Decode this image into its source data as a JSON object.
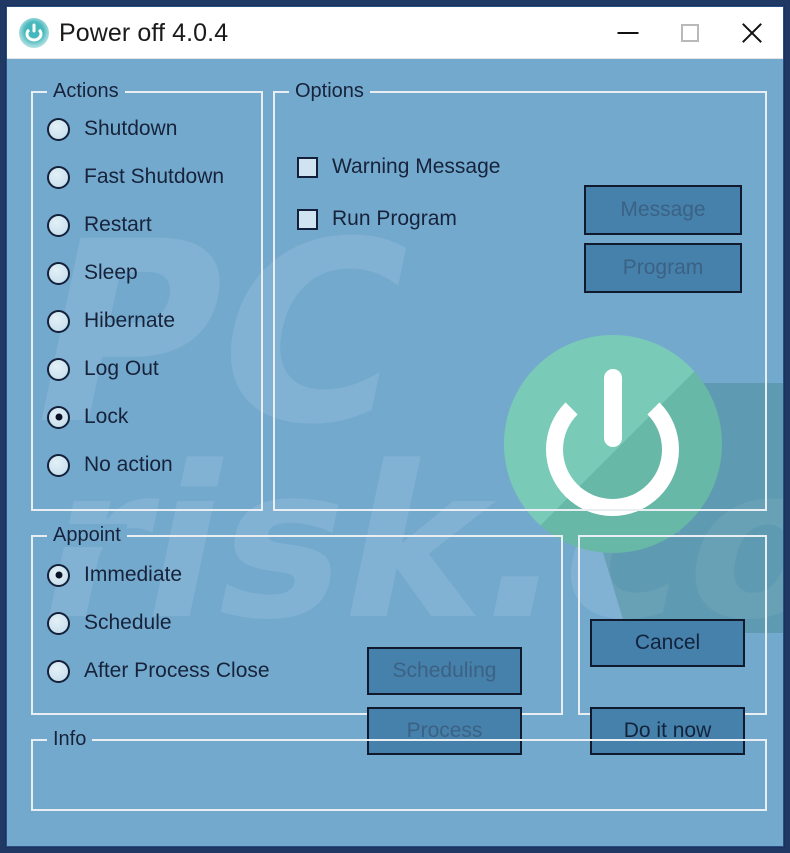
{
  "window": {
    "title": "Power off 4.0.4",
    "icon": "power-icon",
    "accent_background": "#74a9ce",
    "button_fill": "#4681ab",
    "frame_border": "#1f3864",
    "hero_disc_color": "#79cbb8",
    "controls": {
      "minimize": "minimize-icon",
      "maximize": "maximize-icon",
      "close": "close-icon"
    }
  },
  "watermark": {
    "line1": "PC",
    "line2": "risk.com"
  },
  "actions": {
    "legend": "Actions",
    "selected": "Lock",
    "items": [
      {
        "label": "Shutdown",
        "selected": false
      },
      {
        "label": "Fast Shutdown",
        "selected": false
      },
      {
        "label": "Restart",
        "selected": false
      },
      {
        "label": "Sleep",
        "selected": false
      },
      {
        "label": "Hibernate",
        "selected": false
      },
      {
        "label": "Log Out",
        "selected": false
      },
      {
        "label": "Lock",
        "selected": true
      },
      {
        "label": "No action",
        "selected": false
      }
    ]
  },
  "options": {
    "legend": "Options",
    "checkboxes": [
      {
        "label": "Warning Message",
        "checked": false
      },
      {
        "label": "Run Program",
        "checked": false
      }
    ],
    "buttons": [
      {
        "label": "Message",
        "enabled": false
      },
      {
        "label": "Program",
        "enabled": false
      }
    ]
  },
  "appoint": {
    "legend": "Appoint",
    "selected": "Immediate",
    "items": [
      {
        "label": "Immediate",
        "selected": true
      },
      {
        "label": "Schedule",
        "selected": false
      },
      {
        "label": "After Process Close",
        "selected": false
      }
    ],
    "buttons": [
      {
        "label": "Scheduling",
        "enabled": false
      },
      {
        "label": "Process",
        "enabled": false
      }
    ]
  },
  "command_buttons": [
    {
      "label": "Cancel",
      "enabled": true
    },
    {
      "label": "Do it now",
      "enabled": true
    }
  ],
  "info": {
    "legend": "Info",
    "text": ""
  }
}
